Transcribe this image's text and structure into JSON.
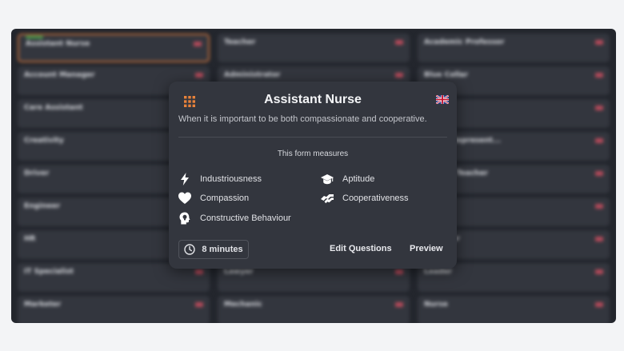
{
  "background": {
    "cards": [
      {
        "title": "Assistant Nurse",
        "sub": "",
        "highlight": true,
        "new": true
      },
      {
        "title": "Teacher",
        "sub": "",
        "highlight": false,
        "new": false
      },
      {
        "title": "Academic Professor",
        "sub": "",
        "highlight": false,
        "new": false
      },
      {
        "title": "Account Manager",
        "sub": "",
        "highlight": false,
        "new": false
      },
      {
        "title": "Administrator",
        "sub": "",
        "highlight": false,
        "new": false
      },
      {
        "title": "Blue Collar",
        "sub": "",
        "highlight": false,
        "new": false
      },
      {
        "title": "Care Assistant",
        "sub": "",
        "highlight": false,
        "new": false
      },
      {
        "title": "",
        "sub": "",
        "highlight": false,
        "new": false
      },
      {
        "title": "",
        "sub": "",
        "highlight": false,
        "new": false
      },
      {
        "title": "Creativity",
        "sub": "",
        "highlight": false,
        "new": false
      },
      {
        "title": "",
        "sub": "",
        "highlight": false,
        "new": false
      },
      {
        "title": "...vice Represent...",
        "sub": "",
        "highlight": false,
        "new": false
      },
      {
        "title": "Driver",
        "sub": "",
        "highlight": false,
        "new": false
      },
      {
        "title": "",
        "sub": "",
        "highlight": false,
        "new": false
      },
      {
        "title": "...chool Teacher",
        "sub": "",
        "highlight": false,
        "new": false
      },
      {
        "title": "Engineer",
        "sub": "",
        "highlight": false,
        "new": false
      },
      {
        "title": "",
        "sub": "",
        "highlight": false,
        "new": false
      },
      {
        "title": "",
        "sub": "",
        "highlight": false,
        "new": false
      },
      {
        "title": "HR",
        "sub": "",
        "highlight": false,
        "new": false
      },
      {
        "title": "",
        "sub": "",
        "highlight": false,
        "new": false
      },
      {
        "title": "...eacher",
        "sub": "",
        "highlight": false,
        "new": false
      },
      {
        "title": "IT Specialist",
        "sub": "",
        "highlight": false,
        "new": false
      },
      {
        "title": "Lawyer",
        "sub": "",
        "highlight": false,
        "new": false
      },
      {
        "title": "Leader",
        "sub": "",
        "highlight": false,
        "new": false
      },
      {
        "title": "Marketer",
        "sub": "",
        "highlight": false,
        "new": false
      },
      {
        "title": "Mechanic",
        "sub": "",
        "highlight": false,
        "new": false
      },
      {
        "title": "Nurse",
        "sub": "",
        "highlight": false,
        "new": false
      }
    ]
  },
  "modal": {
    "title": "Assistant Nurse",
    "description": "When it is important to be both compassionate and cooperative.",
    "measures_heading": "This form measures",
    "traits": [
      {
        "label": "Industriousness",
        "icon": "lightning-icon"
      },
      {
        "label": "Compassion",
        "icon": "heart-icon"
      },
      {
        "label": "Constructive Behaviour",
        "icon": "lightbulb-head-icon"
      },
      {
        "label": "Aptitude",
        "icon": "graduation-cap-icon"
      },
      {
        "label": "Cooperativeness",
        "icon": "handshake-icon"
      }
    ],
    "duration": "8 minutes",
    "edit_label": "Edit Questions",
    "preview_label": "Preview",
    "colors": {
      "accent": "#e8823a",
      "card": "#33363e",
      "backdrop": "#23262d"
    }
  }
}
